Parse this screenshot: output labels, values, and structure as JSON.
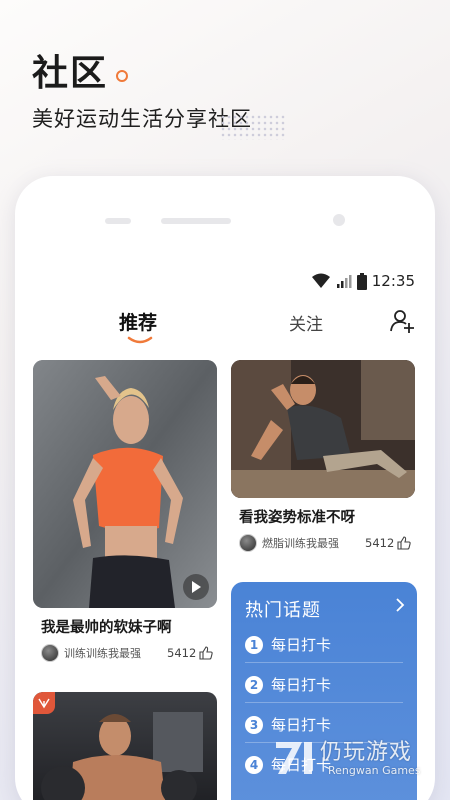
{
  "promo": {
    "title": "社区",
    "subtitle": "美好运动生活分享社区"
  },
  "status_bar": {
    "time": "12:35"
  },
  "tabs": {
    "recommend": "推荐",
    "follow": "关注"
  },
  "feed": {
    "left_cards": [
      {
        "title": "我是最帅的软妹子啊",
        "author": "训练训练我最强",
        "likes": "5412"
      }
    ],
    "right_cards": [
      {
        "title": "看我姿势标准不呀",
        "author": "燃脂训练我最强",
        "likes": "5412"
      }
    ]
  },
  "hot_topics": {
    "header": "热门话题",
    "items": [
      {
        "num": "1",
        "label": "每日打卡"
      },
      {
        "num": "2",
        "label": "每日打卡"
      },
      {
        "num": "3",
        "label": "每日打卡"
      },
      {
        "num": "4",
        "label": "每日打卡"
      }
    ]
  },
  "watermark": {
    "cn": "仍玩游戏",
    "en": "Rengwan Games"
  },
  "colors": {
    "accent": "#f07a3a",
    "topic_panel": "#4a83d6"
  },
  "icons": [
    "wifi-icon",
    "signal-icon",
    "battery-icon",
    "add-user-icon",
    "play-icon",
    "thumb-up-icon",
    "chevron-right-icon",
    "video-badge-icon"
  ]
}
